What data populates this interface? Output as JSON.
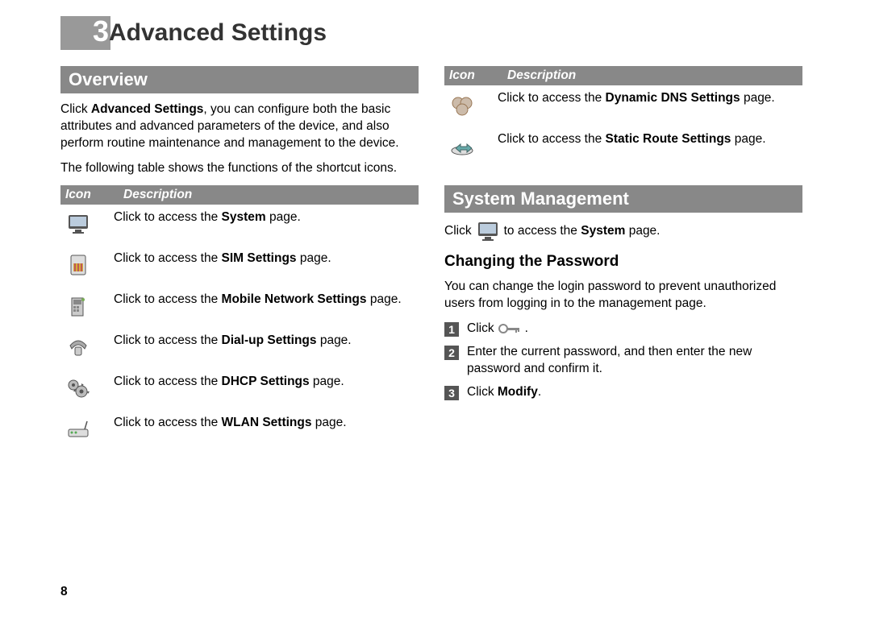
{
  "chapter": {
    "num": "3",
    "title": "Advanced Settings"
  },
  "pageNumber": "8",
  "left": {
    "overviewHeading": "Overview",
    "para1": {
      "pre": "Click ",
      "bold": "Advanced Settings",
      "post": ", you can configure both the basic attributes and advanced parameters of the device, and also perform routine maintenance and management to the device."
    },
    "para2": "The following table shows the functions of the shortcut icons.",
    "table": {
      "header": {
        "icon": "Icon",
        "desc": "Description"
      },
      "rows": [
        {
          "pre": "Click to access the ",
          "bold": "System",
          "post": " page."
        },
        {
          "pre": "Click to access the ",
          "bold": "SIM Settings",
          "post": " page."
        },
        {
          "pre": "Click to access the ",
          "bold": "Mobile Network Settings",
          "post": " page."
        },
        {
          "pre": "Click to access the ",
          "bold": "Dial-up Settings",
          "post": " page."
        },
        {
          "pre": "Click to access the ",
          "bold": "DHCP Settings",
          "post": " page."
        },
        {
          "pre": "Click to access the ",
          "bold": "WLAN Settings",
          "post": " page."
        }
      ]
    }
  },
  "right": {
    "table": {
      "header": {
        "icon": "Icon",
        "desc": "Description"
      },
      "rows": [
        {
          "pre": "Click to access the ",
          "bold": "Dynamic DNS Settings",
          "post": " page."
        },
        {
          "pre": "Click to access the ",
          "bold": "Static Route Settings",
          "post": " page."
        }
      ]
    },
    "sysHeading": "System Management",
    "sysLine": {
      "pre": "Click",
      "post": "to access the ",
      "bold": "System",
      "end": " page."
    },
    "subHeading": "Changing the Password",
    "subPara": "You can change the login password to prevent unauthorized users from logging in to the management page.",
    "steps": [
      {
        "num": "1",
        "pre": "Click ",
        "hasIcon": true,
        "post": " ."
      },
      {
        "num": "2",
        "text": "Enter the current password, and then enter the new password and confirm it."
      },
      {
        "num": "3",
        "pre": "Click ",
        "bold": "Modify",
        "post": "."
      }
    ]
  }
}
